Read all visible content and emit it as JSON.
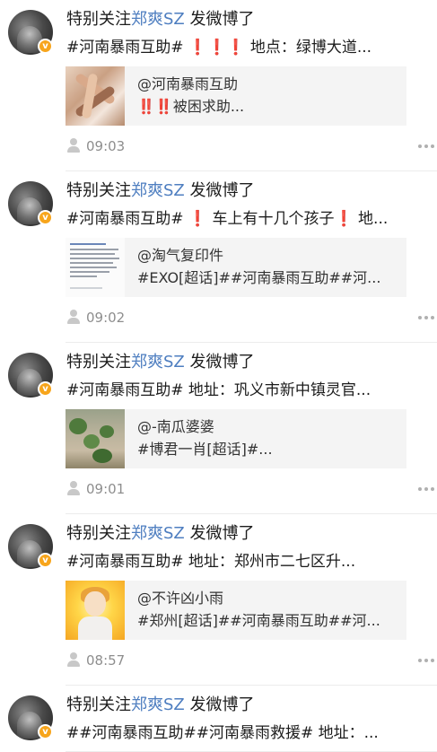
{
  "posts": [
    {
      "title_prefix": "特别关注",
      "author": "郑爽SZ",
      "title_suffix": " 发微博了",
      "summary_parts": [
        "#河南暴雨互助# ",
        "❗❗❗",
        " 地点：绿博大道..."
      ],
      "card": {
        "user": "@河南暴雨互助",
        "text_parts": [
          "‼️‼️",
          "被困求助..."
        ]
      },
      "time": "09:03"
    },
    {
      "title_prefix": "特别关注",
      "author": "郑爽SZ",
      "title_suffix": " 发微博了",
      "summary_parts": [
        "#河南暴雨互助# ",
        "❗",
        " 车上有十几个孩子",
        "❗",
        " 地..."
      ],
      "card": {
        "user": "@淘气复印件",
        "text_parts": [
          "#EXO[超话]##河南暴雨互助##河..."
        ]
      },
      "time": "09:02"
    },
    {
      "title_prefix": "特别关注",
      "author": "郑爽SZ",
      "title_suffix": " 发微博了",
      "summary_parts": [
        "#河南暴雨互助# 地址：巩义市新中镇灵官..."
      ],
      "card": {
        "user": "@-南瓜婆婆",
        "text_parts": [
          "#博君一肖[超话]#..."
        ]
      },
      "time": "09:01"
    },
    {
      "title_prefix": "特别关注",
      "author": "郑爽SZ",
      "title_suffix": " 发微博了",
      "summary_parts": [
        "#河南暴雨互助#  地址：郑州市二七区升..."
      ],
      "card": {
        "user": "@不许凶小雨",
        "text_parts": [
          "#郑州[超话]##河南暴雨互助##河..."
        ]
      },
      "time": "08:57"
    },
    {
      "title_prefix": "特别关注",
      "author": "郑爽SZ",
      "title_suffix": " 发微博了",
      "summary_parts": [
        "##河南暴雨互助##河南暴雨救援#  地址：..."
      ]
    }
  ],
  "colors": {
    "author_link": "#4e7ec0",
    "alert_red": "#e0262d",
    "meta_gray": "#8e8e8e",
    "card_bg": "#f4f4f4",
    "verified_badge": "#f7a51c"
  },
  "icons": {
    "verified": "verified-badge-icon",
    "user": "person-icon",
    "more": "more-dots-icon"
  }
}
